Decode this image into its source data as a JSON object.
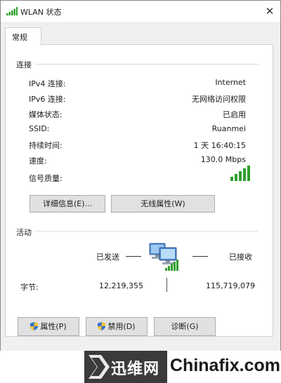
{
  "window": {
    "title": "WLAN 状态",
    "close_glyph": "✕"
  },
  "tabs": [
    {
      "label": "常规"
    }
  ],
  "connection": {
    "section_label": "连接",
    "rows": [
      {
        "label": "IPv4 连接:",
        "value": "Internet"
      },
      {
        "label": "IPv6 连接:",
        "value": "无网络访问权限"
      },
      {
        "label": "媒体状态:",
        "value": "已启用"
      },
      {
        "label": "SSID:",
        "value": "Ruanmei"
      },
      {
        "label": "持续时间:",
        "value": "1 天 16:40:15"
      },
      {
        "label": "速度:",
        "value": "130.0 Mbps"
      },
      {
        "label": "信号质量:",
        "value": ""
      }
    ],
    "signal_level": 1.0,
    "details_button": "详细信息(E)...",
    "wireless_props_button": "无线属性(W)"
  },
  "activity": {
    "section_label": "活动",
    "sent_label": "已发送",
    "received_label": "已接收",
    "bytes_label": "字节:",
    "bytes_sent": "12,219,355",
    "bytes_received": "115,719,079"
  },
  "buttons": {
    "properties": "属性(P)",
    "disable": "禁用(D)",
    "diagnose": "诊断(G)"
  },
  "watermark": {
    "brand_cn": "迅维网",
    "brand_en": "Chinafix.com"
  },
  "colors": {
    "signal": "#2e9e2e",
    "watermark_dark": "#3b3b3b"
  }
}
